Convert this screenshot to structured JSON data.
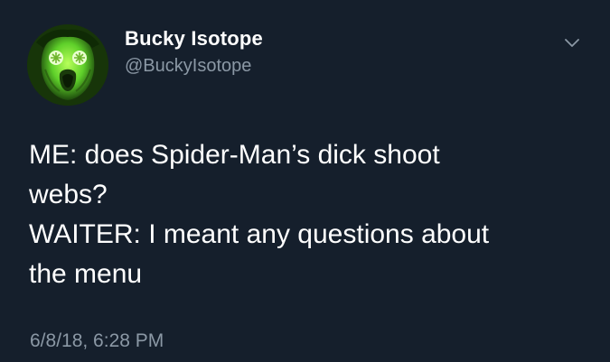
{
  "tweet": {
    "author": {
      "display_name": "Bucky Isotope",
      "handle": "@BuckyIsotope",
      "avatar_icon": "green-face-avatar-icon"
    },
    "menu_icon": "chevron-down-icon",
    "text_lines": [
      "ME: does Spider-Man’s dick shoot",
      "webs?",
      "WAITER: I meant any questions about",
      "the menu"
    ],
    "timestamp": "6/8/18, 6:28 PM"
  },
  "colors": {
    "background": "#151f2c",
    "primary_text": "#ffffff",
    "secondary_text": "#8b98a5",
    "avatar_accent": "#7ee03a"
  }
}
